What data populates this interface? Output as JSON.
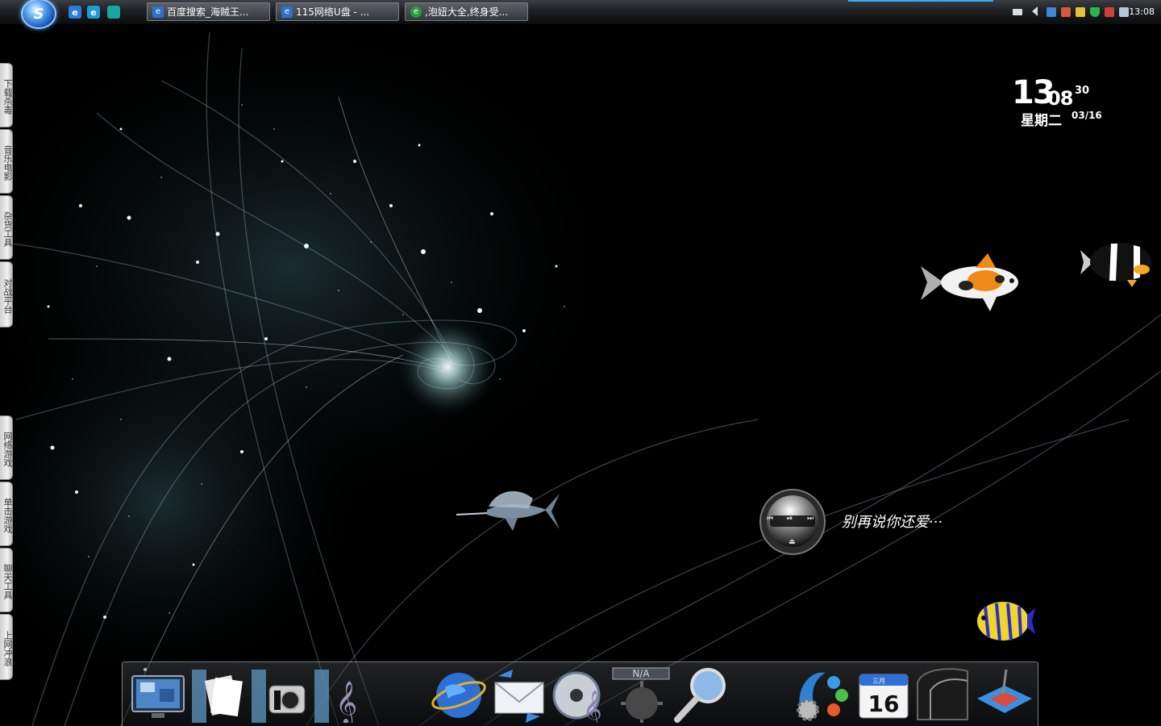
{
  "taskbar": {
    "start_label": "S",
    "quick_launch": [
      {
        "icon": "ie-icon",
        "label": "e",
        "color": "#2a7de1"
      },
      {
        "icon": "ie-alt-icon",
        "label": "e",
        "color": "#1d9bd8"
      },
      {
        "icon": "show-desktop-icon",
        "label": "",
        "color": "#19a5a0"
      }
    ],
    "tasks": [
      {
        "label": "百度搜索_海贼王...",
        "icon": "ie-page-icon",
        "icon_color": "#2d72c9"
      },
      {
        "label": "115网络U盘 - ...",
        "icon": "ie-page-icon",
        "icon_color": "#2d72c9"
      },
      {
        "label": ",泡妞大全,终身受...",
        "icon": "browser-green-icon",
        "icon_color": "#2b9a3a"
      }
    ],
    "tray": {
      "icons": [
        "keyboard-icon",
        "expand-tray-icon",
        "network-icon",
        "user-icon",
        "security-alert-icon",
        "shield-icon",
        "antivirus-icon",
        "volume-icon"
      ],
      "time": "13:08"
    }
  },
  "side_tabs": [
    {
      "label": "下载杀毒"
    },
    {
      "label": "音乐电影"
    },
    {
      "label": "杂货工具"
    },
    {
      "label": "对战平台"
    },
    {
      "label": "网络游戏"
    },
    {
      "label": "单击游戏"
    },
    {
      "label": "聊天工具"
    },
    {
      "label": "上网冲浪"
    }
  ],
  "clock": {
    "hour": "13",
    "minute": "08",
    "second": "30",
    "weekday": "星期二",
    "date": "03/16"
  },
  "media_player": {
    "title": "别再说你还爱···",
    "prev": "⏮",
    "play": "⏯",
    "next": "⏭",
    "eject": "⏏"
  },
  "dock": {
    "items": [
      {
        "name": "dock-computer-icon"
      },
      {
        "name": "dock-documents-icon"
      },
      {
        "name": "dock-pictures-icon"
      },
      {
        "name": "dock-music-icon"
      },
      {
        "name": "dock-internet-icon"
      },
      {
        "name": "dock-mail-icon"
      },
      {
        "name": "dock-media-player-icon"
      },
      {
        "name": "dock-weather-icon",
        "label": "N/A"
      },
      {
        "name": "dock-search-icon"
      },
      {
        "name": "dock-settings-icon"
      },
      {
        "name": "dock-calendar-icon",
        "month": "三月",
        "day": "16"
      },
      {
        "name": "dock-stack-icon"
      },
      {
        "name": "dock-tools-icon"
      }
    ]
  }
}
